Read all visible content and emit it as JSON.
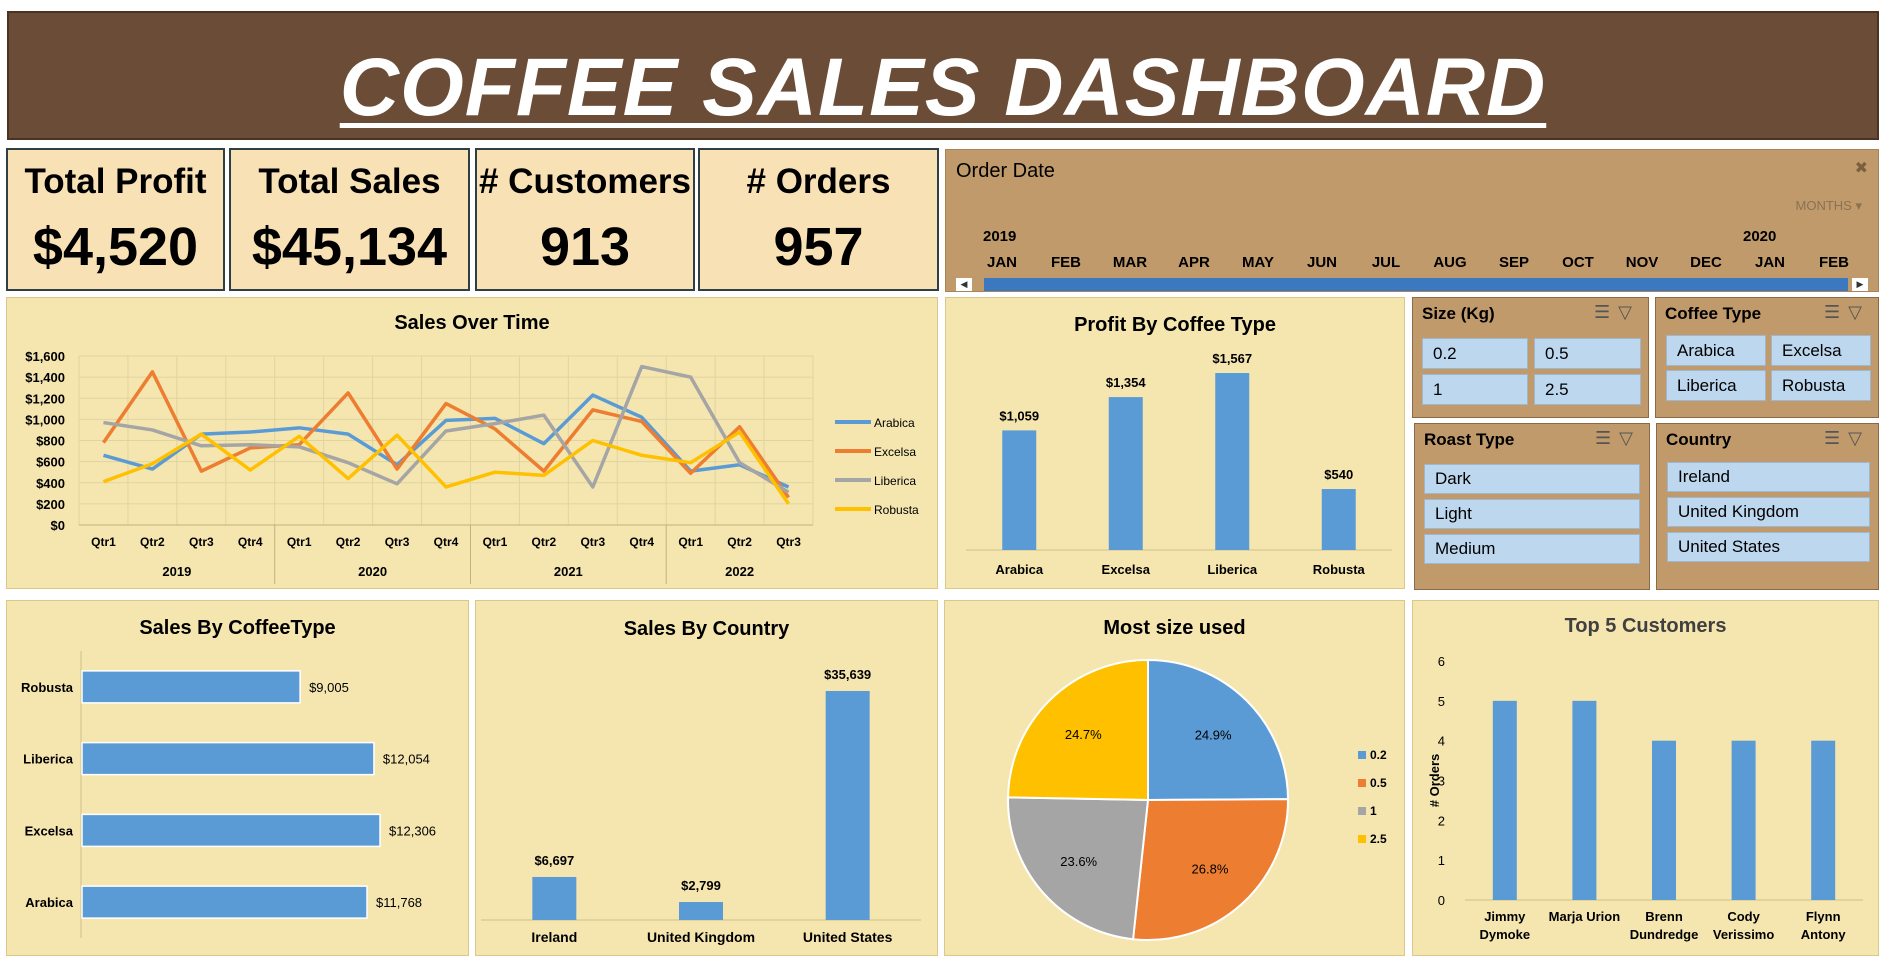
{
  "header": {
    "title": "COFFEE SALES DASHBOARD"
  },
  "kpis": [
    {
      "label": "Total Profit",
      "value": "$4,520"
    },
    {
      "label": "Total Sales",
      "value": "$45,134"
    },
    {
      "label": "# Customers",
      "value": "913"
    },
    {
      "label": "# Orders",
      "value": "957"
    }
  ],
  "timeline": {
    "title": "Order Date",
    "level": "MONTHS",
    "years": [
      "2019",
      "2020"
    ],
    "months": [
      "JAN",
      "FEB",
      "MAR",
      "APR",
      "MAY",
      "JUN",
      "JUL",
      "AUG",
      "SEP",
      "OCT",
      "NOV",
      "DEC",
      "JAN",
      "FEB"
    ]
  },
  "slicers": {
    "size": {
      "title": "Size (Kg)",
      "items": [
        "0.2",
        "0.5",
        "1",
        "2.5"
      ]
    },
    "coffee_type": {
      "title": "Coffee Type",
      "items": [
        "Arabica",
        "Excelsa",
        "Liberica",
        "Robusta"
      ]
    },
    "roast_type": {
      "title": "Roast Type",
      "items": [
        "Dark",
        "Light",
        "Medium"
      ]
    },
    "country": {
      "title": "Country",
      "items": [
        "Ireland",
        "United Kingdom",
        "United States"
      ]
    }
  },
  "colors": {
    "arabica": "#5b9bd5",
    "excelsa": "#ed7d31",
    "liberica": "#a5a5a5",
    "robusta": "#ffc000",
    "bar": "#5b9bd5",
    "panel": "#f5e6b0",
    "header": "#6b4c36"
  },
  "chart_data": [
    {
      "id": "sales_over_time",
      "type": "line",
      "title": "Sales Over Time",
      "categories": [
        "Qtr1",
        "Qtr2",
        "Qtr3",
        "Qtr4",
        "Qtr1",
        "Qtr2",
        "Qtr3",
        "Qtr4",
        "Qtr1",
        "Qtr2",
        "Qtr3",
        "Qtr4",
        "Qtr1",
        "Qtr2",
        "Qtr3"
      ],
      "groups": [
        {
          "label": "2019",
          "count": 4
        },
        {
          "label": "2020",
          "count": 4
        },
        {
          "label": "2021",
          "count": 4
        },
        {
          "label": "2022",
          "count": 3
        }
      ],
      "yticks": [
        "$0",
        "$200",
        "$400",
        "$600",
        "$800",
        "$1,000",
        "$1,200",
        "$1,400",
        "$1,600"
      ],
      "ylim": [
        0,
        1600
      ],
      "legend": "right",
      "series": [
        {
          "name": "Arabica",
          "values": [
            660,
            530,
            860,
            880,
            920,
            860,
            570,
            990,
            1010,
            770,
            1230,
            1020,
            510,
            570,
            360
          ]
        },
        {
          "name": "Excelsa",
          "values": [
            780,
            1450,
            510,
            730,
            760,
            1250,
            530,
            1150,
            910,
            510,
            1090,
            980,
            490,
            930,
            260
          ]
        },
        {
          "name": "Liberica",
          "values": [
            970,
            900,
            750,
            760,
            740,
            590,
            390,
            890,
            960,
            1040,
            360,
            1500,
            1400,
            590,
            310
          ]
        },
        {
          "name": "Robusta",
          "values": [
            410,
            580,
            860,
            520,
            840,
            440,
            850,
            360,
            500,
            470,
            800,
            660,
            590,
            880,
            200
          ]
        }
      ]
    },
    {
      "id": "profit_by_coffee_type",
      "type": "bar",
      "title": "Profit By Coffee Type",
      "categories": [
        "Arabica",
        "Excelsa",
        "Liberica",
        "Robusta"
      ],
      "values": [
        1059,
        1354,
        1567,
        540
      ],
      "labels": [
        "$1,059",
        "$1,354",
        "$1,567",
        "$540"
      ],
      "ylim": [
        0,
        1700
      ]
    },
    {
      "id": "sales_by_coffeetype",
      "type": "bar",
      "orientation": "horizontal",
      "title": "Sales By CoffeeType",
      "categories": [
        "Robusta",
        "Liberica",
        "Excelsa",
        "Arabica"
      ],
      "values": [
        9005,
        12054,
        12306,
        11768
      ],
      "labels": [
        "$9,005",
        "$12,054",
        "$12,306",
        "$11,768"
      ],
      "xlim": [
        0,
        14000
      ]
    },
    {
      "id": "sales_by_country",
      "type": "bar",
      "title": "Sales By Country",
      "categories": [
        "Ireland",
        "United Kingdom",
        "United States"
      ],
      "values": [
        6697,
        2799,
        35639
      ],
      "labels": [
        "$6,697",
        "$2,799",
        "$35,639"
      ],
      "ylim": [
        0,
        37000
      ]
    },
    {
      "id": "most_size_used",
      "type": "pie",
      "title": "Most size used",
      "categories": [
        "0.2",
        "0.5",
        "1",
        "2.5"
      ],
      "values": [
        24.9,
        26.8,
        23.6,
        24.7
      ],
      "labels": [
        "24.9%",
        "26.8%",
        "23.6%",
        "24.7%"
      ],
      "legend": "right"
    },
    {
      "id": "top_5_customers",
      "type": "bar",
      "title": "Top 5 Customers",
      "categories": [
        [
          "Jimmy",
          "Dymoke"
        ],
        [
          "Marja Urion"
        ],
        [
          "Brenn",
          "Dundredge"
        ],
        [
          "Cody",
          "Verissimo"
        ],
        [
          "Flynn",
          "Antony"
        ]
      ],
      "values": [
        5,
        5,
        4,
        4,
        4
      ],
      "ylabel": "# Orders",
      "yticks": [
        "0",
        "1",
        "2",
        "3",
        "4",
        "5",
        "6"
      ],
      "ylim": [
        0,
        6
      ]
    }
  ]
}
